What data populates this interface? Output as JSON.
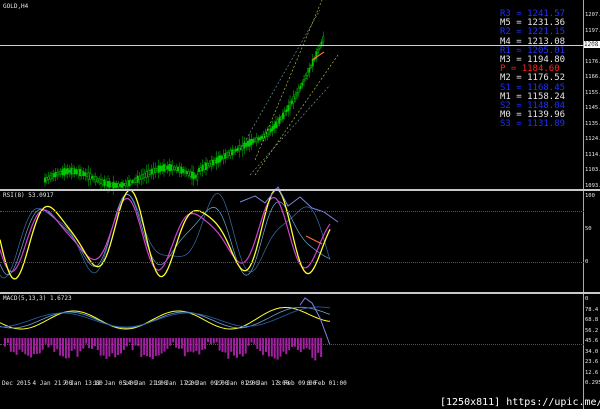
{
  "chart": {
    "symbol": "GOLD,H4",
    "accent": "#00cc00",
    "current_price_badge": "1208.6"
  },
  "panes": {
    "pane2_label": "RSI(8) 53.0917",
    "pane3_label": "MACD(5,13,3) 1.6723"
  },
  "price_axis": {
    "main": [
      "1207.9",
      "1197.6",
      "1187.2",
      "1176.6",
      "1166.3",
      "1155.5",
      "1145.4",
      "1135.0",
      "1124.7",
      "1114.2",
      "1103.9",
      "1093.6"
    ],
    "pane2": [
      "100",
      "50",
      "0"
    ],
    "pane3": [
      "0",
      "78.4",
      "68.8",
      "56.2",
      "45.6",
      "34.0",
      "23.6",
      "12.6",
      "0.2955"
    ]
  },
  "pivots": [
    {
      "name": "R3",
      "value": "1241.57",
      "color": "#1c2fff"
    },
    {
      "name": "M5",
      "value": "1231.36",
      "color": "#e6e6e6"
    },
    {
      "name": "R2",
      "value": "1221.15",
      "color": "#1c2fff"
    },
    {
      "name": "M4",
      "value": "1213.08",
      "color": "#e6e6e6"
    },
    {
      "name": "R1",
      "value": "1205.01",
      "color": "#1c2fff"
    },
    {
      "name": "M3",
      "value": "1194.80",
      "color": "#e6e6e6"
    },
    {
      "name": "P",
      "value": "1184.60",
      "color": "#ff2020"
    },
    {
      "name": "M2",
      "value": "1176.52",
      "color": "#e6e6e6"
    },
    {
      "name": "S1",
      "value": "1168.45",
      "color": "#1c2fff"
    },
    {
      "name": "M1",
      "value": "1158.24",
      "color": "#e6e6e6"
    },
    {
      "name": "S2",
      "value": "1148.04",
      "color": "#1c2fff"
    },
    {
      "name": "M0",
      "value": "1139.96",
      "color": "#e6e6e6"
    },
    {
      "name": "S3",
      "value": "1131.89",
      "color": "#1c2fff"
    }
  ],
  "time_axis": [
    "Dec 2015",
    "4 Jan 21:00",
    "7 Jan 13:00",
    "12 Jan 05:00",
    "14 Jan 21:00",
    "19 Jan 17:00",
    "22 Jan 09:00",
    "27 Jan 01:00",
    "29 Jan 17:00",
    "3 Feb 09:00",
    "8 Feb 01:00"
  ],
  "footer": "[1250x811] https://upic.me/"
}
